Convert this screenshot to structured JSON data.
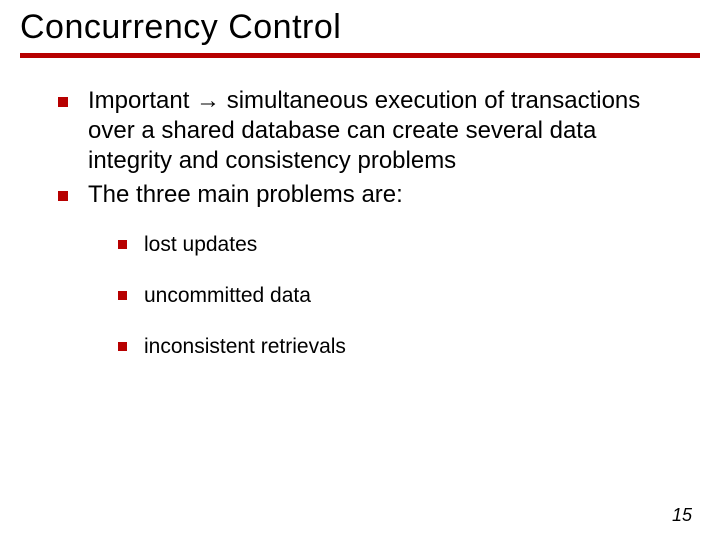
{
  "title": "Concurrency Control",
  "bullets": {
    "b1_pre": "Important ",
    "b1_arrow": "→",
    "b1_post": " simultaneous execution of transactions over a shared database can create several data integrity and consistency problems",
    "b2": "The three main problems are:",
    "sub": {
      "s1": "lost updates",
      "s2": "uncommitted data",
      "s3": "inconsistent retrievals"
    }
  },
  "page_number": "15"
}
